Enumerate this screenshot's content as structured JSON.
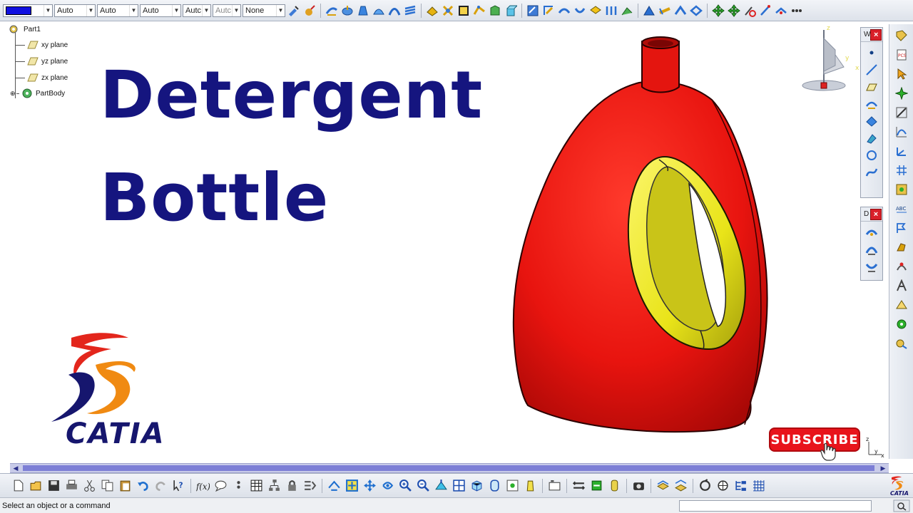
{
  "toolbar": {
    "color_swatch": "#1010e0",
    "combos": [
      {
        "id": "line-type",
        "value": "Auto"
      },
      {
        "id": "line-thickness",
        "value": "Auto"
      },
      {
        "id": "point-type",
        "value": "Auto"
      },
      {
        "id": "layer-a",
        "value": "Autc"
      },
      {
        "id": "layer-b",
        "value": "Autc"
      },
      {
        "id": "render-style",
        "value": "None"
      }
    ]
  },
  "tree": {
    "root": "Part1",
    "items": [
      "xy plane",
      "yz plane",
      "zx plane",
      "PartBody"
    ]
  },
  "headline": {
    "line1": "Detergent",
    "line2": "Bottle"
  },
  "logo": {
    "brand_text": "CATIA",
    "colors": {
      "red": "#e3261c",
      "orange": "#f08a12",
      "navy": "#16166e"
    }
  },
  "model": {
    "body_color": "#e8140f",
    "handle_color": "#e9e419"
  },
  "panels": {
    "wireframe_label": "W",
    "dress_label": "D",
    "close_glyph": "×"
  },
  "compass": {
    "x_label": "x",
    "y_label": "y",
    "z_label": "z"
  },
  "axis_mini": {
    "x_label": "x",
    "y_label": "y",
    "z_label": "z"
  },
  "subscribe": {
    "label": "SUBSCRIBE"
  },
  "status": {
    "message": "Select an object or a command",
    "command_value": ""
  }
}
